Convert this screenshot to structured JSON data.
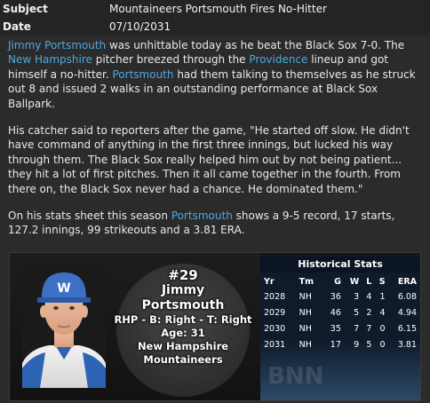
{
  "header": {
    "subject_label": "Subject",
    "subject_value": "Mountaineers Portsmouth Fires No-Hitter",
    "date_label": "Date",
    "date_value": "07/10/2031"
  },
  "article": {
    "p1": {
      "link_player": "Jimmy Portsmouth",
      "t1": " was unhittable today as he beat the Black Sox 7-0. The ",
      "link_team": "New Hampshire",
      "t2": " pitcher breezed through the ",
      "link_opponent": "Providence",
      "t3": " lineup and got himself a no-hitter. ",
      "link_player_short": "Portsmouth",
      "t4": " had them talking to themselves as he struck out 8 and issued 2 walks in an outstanding performance at Black Sox Ballpark."
    },
    "p2": "His catcher said to reporters after the game, \"He started off slow. He didn't have command of anything in the first three innings, but lucked his way through them. The Black Sox really helped him out by not being patient... they hit a lot of first pitches. Then it all came together in the fourth. From there on, the Black Sox never had a chance. He dominated them.\"",
    "p3": {
      "t1": "On his stats sheet this season ",
      "link_player_short": "Portsmouth",
      "t2": " shows a 9-5 record, 17 starts, 127.2 innings, 99 strikeouts and a 3.81 ERA."
    }
  },
  "player_card": {
    "number": "#29",
    "first_name": "Jimmy",
    "last_name": "Portsmouth",
    "bio": "RHP - B: Right - T: Right",
    "age": "Age: 31",
    "team": "New Hampshire Mountaineers",
    "cap_letter": "W"
  },
  "historical_stats": {
    "title": "Historical Stats",
    "columns": [
      "Yr",
      "Tm",
      "G",
      "W",
      "L",
      "S",
      "ERA"
    ],
    "rows": [
      [
        "2028",
        "NH",
        "36",
        "3",
        "4",
        "1",
        "6.08"
      ],
      [
        "2029",
        "NH",
        "46",
        "5",
        "2",
        "4",
        "4.94"
      ],
      [
        "2030",
        "NH",
        "35",
        "7",
        "7",
        "0",
        "6.15"
      ],
      [
        "2031",
        "NH",
        "17",
        "9",
        "5",
        "0",
        "3.81"
      ]
    ],
    "watermark": "BNN"
  },
  "colors": {
    "link": "#4ea8e0",
    "background": "#2b2b2b",
    "stats_panel": "#0f1a2a"
  }
}
